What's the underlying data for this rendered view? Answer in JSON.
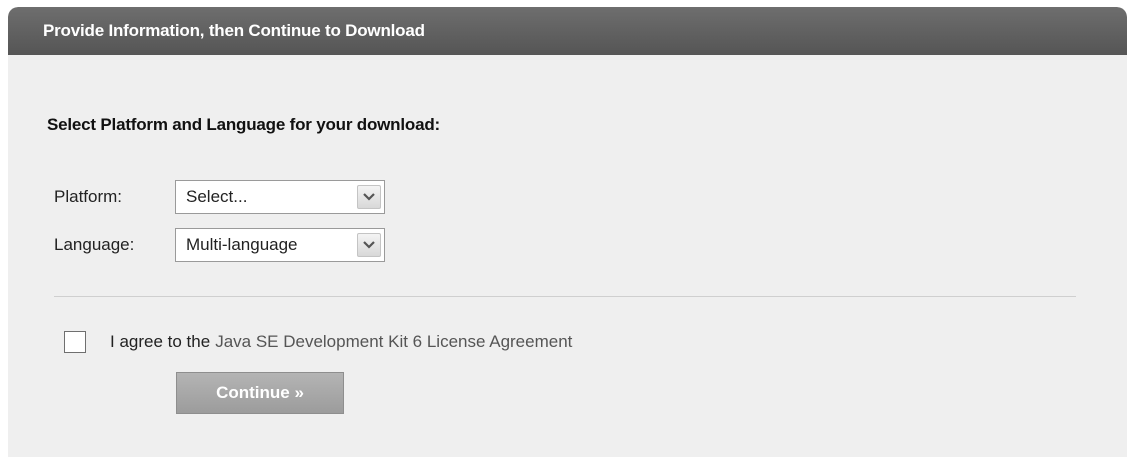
{
  "panel": {
    "header_title": "Provide Information, then Continue to Download"
  },
  "form": {
    "section_title": "Select Platform and Language for your download:",
    "platform": {
      "label": "Platform:",
      "selected_value": "Select..."
    },
    "language": {
      "label": "Language:",
      "selected_value": "Multi-language"
    },
    "agreement": {
      "checked": false,
      "prefix_text": "I agree to the",
      "link_text": "Java SE Development Kit 6 License Agreement"
    },
    "continue_label": "Continue »"
  },
  "icons": {
    "select_arrow": "chevron-down-icon",
    "checkbox": "checkbox-unchecked"
  }
}
